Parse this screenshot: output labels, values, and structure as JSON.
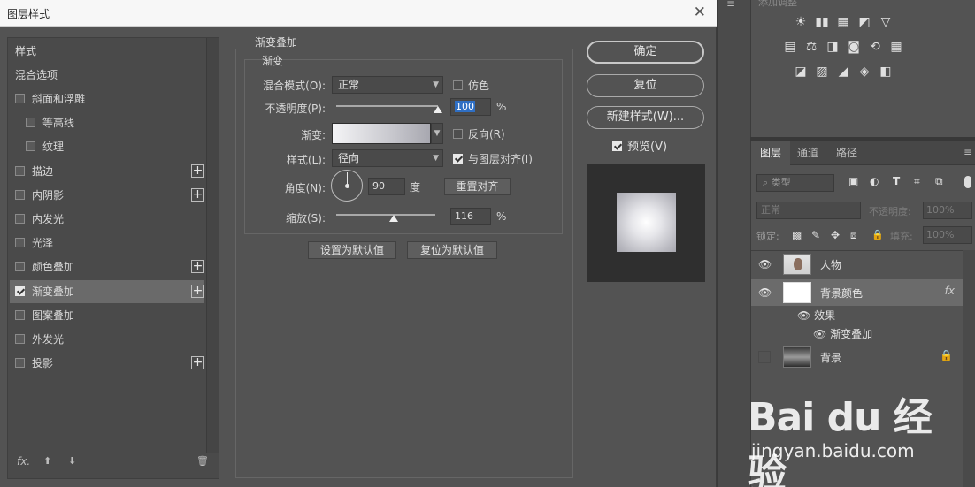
{
  "dialog": {
    "title": "图层样式",
    "close_glyph": "✕",
    "styles_header": "样式",
    "blend_options": "混合选项",
    "items": [
      {
        "label": "斜面和浮雕",
        "checked": false,
        "plus": false,
        "indent": false
      },
      {
        "label": "等高线",
        "checked": false,
        "plus": false,
        "indent": true
      },
      {
        "label": "纹理",
        "checked": false,
        "plus": false,
        "indent": true
      },
      {
        "label": "描边",
        "checked": false,
        "plus": true,
        "indent": false
      },
      {
        "label": "内阴影",
        "checked": false,
        "plus": true,
        "indent": false
      },
      {
        "label": "内发光",
        "checked": false,
        "plus": false,
        "indent": false
      },
      {
        "label": "光泽",
        "checked": false,
        "plus": false,
        "indent": false
      },
      {
        "label": "颜色叠加",
        "checked": false,
        "plus": true,
        "indent": false
      },
      {
        "label": "渐变叠加",
        "checked": true,
        "plus": true,
        "indent": false,
        "selected": true
      },
      {
        "label": "图案叠加",
        "checked": false,
        "plus": false,
        "indent": false
      },
      {
        "label": "外发光",
        "checked": false,
        "plus": false,
        "indent": false
      },
      {
        "label": "投影",
        "checked": false,
        "plus": true,
        "indent": false
      }
    ],
    "plus_glyph": "+",
    "bottom": {
      "fx": "fx.",
      "up": "⬆",
      "down": "⬇",
      "trash": "🗑"
    }
  },
  "gradient_overlay": {
    "group_title": "渐变叠加",
    "sub_title": "渐变",
    "blend_mode_label": "混合模式(O):",
    "blend_mode_value": "正常",
    "dither_label": "仿色",
    "opacity_label": "不透明度(P):",
    "opacity_value": "100",
    "opacity_level": 1.0,
    "percent": "%",
    "gradient_label": "渐变:",
    "reverse_label": "反向(R)",
    "style_label": "样式(L):",
    "style_value": "径向",
    "align_label": "与图层对齐(I)",
    "angle_label": "角度(N):",
    "angle_value": "90",
    "degree_unit": "度",
    "reset_align": "重置对齐",
    "scale_label": "缩放(S):",
    "scale_value": "116",
    "scale_level": 0.58,
    "make_default": "设置为默认值",
    "reset_default": "复位为默认值"
  },
  "actions": {
    "ok": "确定",
    "reset": "复位",
    "new_style": "新建样式(W)...",
    "preview": "预览(V)"
  },
  "adjustments_panel": {
    "header": "添加调整",
    "menu": "≡",
    "row1": [
      "☀",
      "▮▮",
      "▦",
      "◩",
      "▽"
    ],
    "row2": [
      "▤",
      "⚖",
      "◨",
      "◙",
      "⟲",
      "▦"
    ],
    "row3": [
      "◪",
      "▨",
      "◢",
      "◈",
      "◧"
    ]
  },
  "layers_panel": {
    "tabs": [
      "图层",
      "通道",
      "路径"
    ],
    "menu": "≡",
    "filter_placeholder": "类型",
    "filter_icons": [
      "▣",
      "◐",
      "T",
      "⌗",
      "⧉"
    ],
    "blend_mode": "正常",
    "opacity_label": "不透明度:",
    "opacity_value": "100%",
    "lock_label": "锁定:",
    "lock_icons": [
      "▩",
      "✎",
      "✥",
      "⧈",
      "🔒"
    ],
    "fill_label": "填充:",
    "fill_value": "100%",
    "layers": [
      {
        "name": "人物",
        "eye": "👁"
      },
      {
        "name": "背景颜色",
        "eye": "👁",
        "fx": "fx"
      },
      {
        "name": "背景",
        "lock": "🔒"
      }
    ],
    "effects_label": "效果",
    "effect_name": "渐变叠加"
  },
  "watermark": {
    "logo": "Bai du 经验",
    "site": "jingyan.baidu.com"
  }
}
